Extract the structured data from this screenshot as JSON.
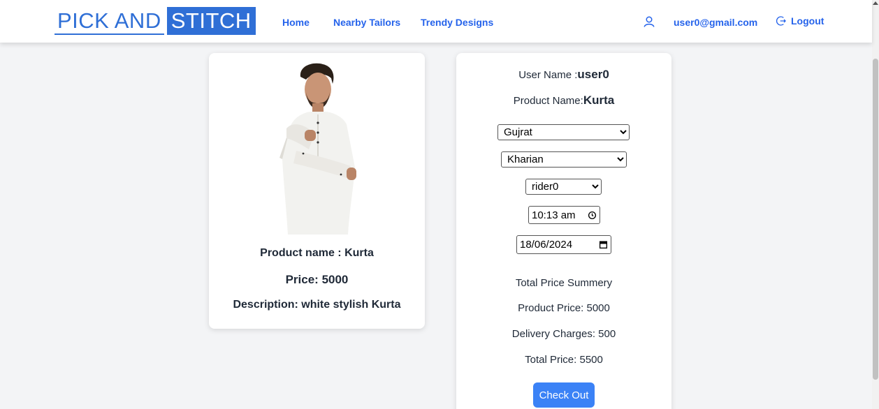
{
  "brand": {
    "part1": "PICK AND",
    "part2": "STITCH"
  },
  "nav": {
    "home": "Home",
    "nearby": "Nearby Tailors",
    "trendy": "Trendy Designs"
  },
  "account": {
    "email": "user0@gmail.com",
    "logout": "Logout"
  },
  "product": {
    "name_line": "Product name : Kurta",
    "price_line": "Price: 5000",
    "description_line": "Description: white stylish Kurta"
  },
  "order": {
    "user_label": "User Name :",
    "user_value": "user0",
    "product_label": "Product Name:",
    "product_value": "Kurta",
    "state_selected": "Gujrat",
    "city_selected": "Kharian",
    "rider_selected": "rider0",
    "time_value": "10:13 am",
    "date_value": "18/06/2024",
    "summary_title": "Total Price Summery",
    "product_price": "Product Price: 5000",
    "delivery_charges": "Delivery Charges: 500",
    "total_price": "Total Price: 5500",
    "checkout_label": "Check Out"
  },
  "colors": {
    "brand_blue": "#2f6fd6",
    "link_blue": "#2563eb",
    "button_blue": "#3b82f6"
  }
}
